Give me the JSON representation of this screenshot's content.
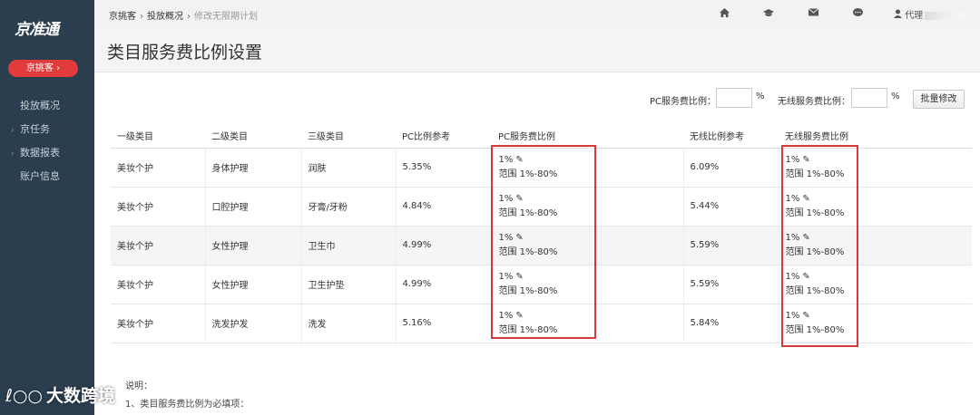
{
  "sidebar": {
    "logo": "京准通",
    "primary_button": "京挑客 ›",
    "nav": [
      {
        "label": "投放概况",
        "chevron": false
      },
      {
        "label": "京任务",
        "chevron": true
      },
      {
        "label": "数据报表",
        "chevron": true
      },
      {
        "label": "账户信息",
        "chevron": false
      }
    ]
  },
  "header": {
    "breadcrumb": [
      "京挑客",
      "投放概况",
      "修改无限期计划"
    ],
    "user": "代理",
    "icons": [
      "home-icon",
      "graduation-cap-icon",
      "mail-icon",
      "chat-icon",
      "user-icon"
    ]
  },
  "page": {
    "title": "类目服务费比例设置"
  },
  "filters": {
    "pc_label": "PC服务费比例：",
    "pc_value": "",
    "pc_unit": "%",
    "mobile_label": "无线服务费比例：",
    "mobile_value": "",
    "mobile_unit": "%",
    "batch_button": "批量修改"
  },
  "table": {
    "headers": [
      "一级类目",
      "二级类目",
      "三级类目",
      "PC比例参考",
      "PC服务费比例",
      "无线比例参考",
      "无线服务费比例"
    ],
    "rows": [
      {
        "c1": "美妆个护",
        "c2": "身体护理",
        "c3": "润肤",
        "pc_ref": "5.35%",
        "pc_rate": "1%",
        "pc_range": "范围 1%-80%",
        "m_ref": "6.09%",
        "m_rate": "1%",
        "m_range": "范围 1%-80%"
      },
      {
        "c1": "美妆个护",
        "c2": "口腔护理",
        "c3": "牙膏/牙粉",
        "pc_ref": "4.84%",
        "pc_rate": "1%",
        "pc_range": "范围 1%-80%",
        "m_ref": "5.44%",
        "m_rate": "1%",
        "m_range": "范围 1%-80%"
      },
      {
        "c1": "美妆个护",
        "c2": "女性护理",
        "c3": "卫生巾",
        "pc_ref": "4.99%",
        "pc_rate": "1%",
        "pc_range": "范围 1%-80%",
        "m_ref": "5.59%",
        "m_rate": "1%",
        "m_range": "范围 1%-80%"
      },
      {
        "c1": "美妆个护",
        "c2": "女性护理",
        "c3": "卫生护垫",
        "pc_ref": "4.99%",
        "pc_rate": "1%",
        "pc_range": "范围 1%-80%",
        "m_ref": "5.59%",
        "m_rate": "1%",
        "m_range": "范围 1%-80%"
      },
      {
        "c1": "美妆个护",
        "c2": "洗发护发",
        "c3": "洗发",
        "pc_ref": "5.16%",
        "pc_rate": "1%",
        "pc_range": "范围 1%-80%",
        "m_ref": "5.84%",
        "m_rate": "1%",
        "m_range": "范围 1%-80%"
      }
    ]
  },
  "notes": {
    "title": "说明：",
    "line1": "1、类目服务费比例为必填项："
  },
  "watermark": "大数跨境",
  "colors": {
    "sidebar": "#2b3e50",
    "accent": "#e23b3b",
    "highlight": "#d53a3a"
  }
}
